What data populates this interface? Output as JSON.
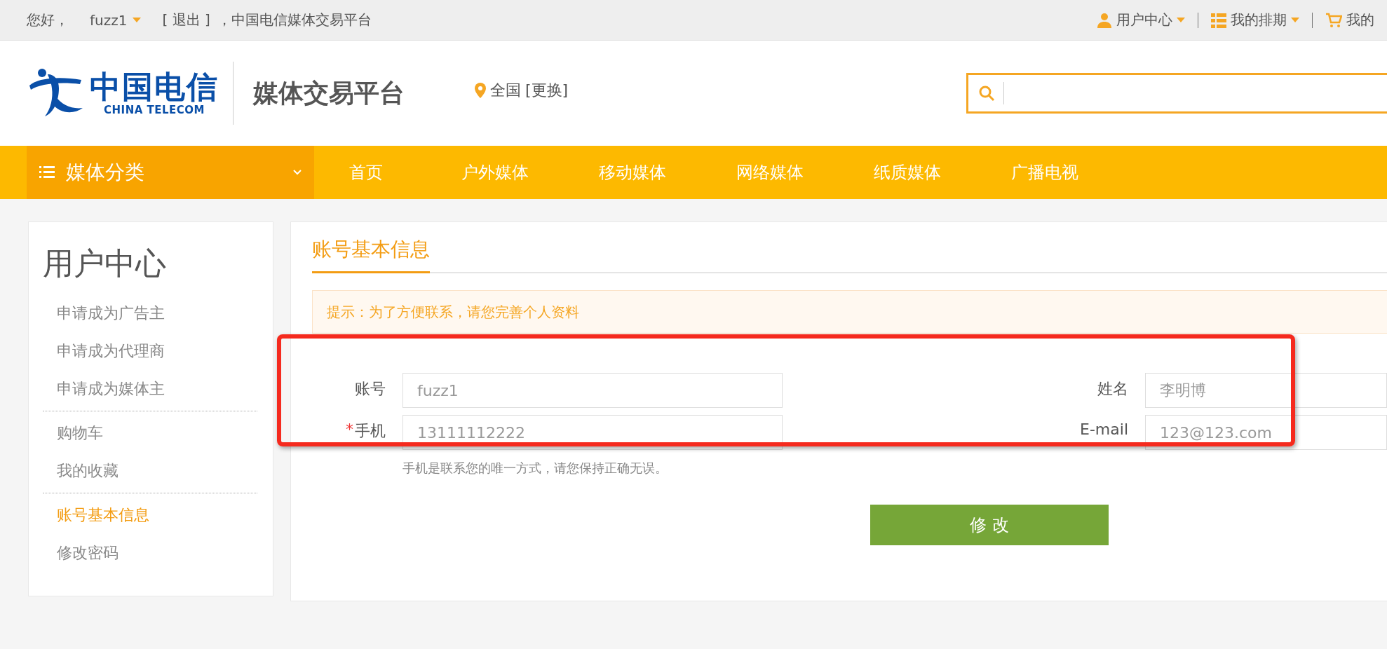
{
  "top_bar": {
    "greeting": "您好，",
    "user": "fuzz1",
    "logout": "[ 退出 ]",
    "site_name": "，中国电信媒体交易平台",
    "links": [
      {
        "kind": "user",
        "label": "用户中心",
        "dropdown": true
      },
      {
        "kind": "schedule",
        "label": "我的排期",
        "dropdown": true
      },
      {
        "kind": "cart",
        "label": "我的",
        "dropdown": false
      }
    ]
  },
  "header": {
    "logo_cn": "中国电信",
    "logo_en": "CHINA TELECOM",
    "platform": "媒体交易平台",
    "location": "全国",
    "change": "[更换]"
  },
  "nav": {
    "category": "媒体分类",
    "items": [
      "首页",
      "户外媒体",
      "移动媒体",
      "网络媒体",
      "纸质媒体",
      "广播电视"
    ]
  },
  "sidebar": {
    "title": "用户中心",
    "groups": [
      [
        {
          "label": "申请成为广告主",
          "selected": false
        },
        {
          "label": "申请成为代理商",
          "selected": false
        },
        {
          "label": "申请成为媒体主",
          "selected": false
        }
      ],
      [
        {
          "label": "购物车",
          "selected": false
        },
        {
          "label": "我的收藏",
          "selected": false
        }
      ],
      [
        {
          "label": "账号基本信息",
          "selected": true
        },
        {
          "label": "修改密码",
          "selected": false
        }
      ]
    ]
  },
  "main": {
    "tab": "账号基本信息",
    "hint": "提示：为了方便联系，请您完善个人资料",
    "fields": [
      {
        "label": "账号",
        "value": "fuzz1"
      },
      {
        "label": "姓名",
        "value": "李明博"
      },
      {
        "label": "手机",
        "value": "13111112222",
        "mark": "*",
        "help": "手机是联系您的唯一方式，请您保持正确无误。"
      },
      {
        "label": "E-mail",
        "value": "123@123.com"
      }
    ],
    "button": "修 改"
  }
}
